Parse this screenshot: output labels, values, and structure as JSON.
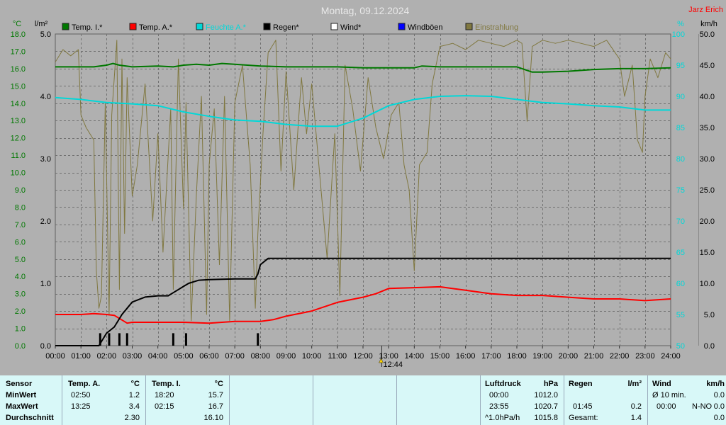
{
  "title": "Montag, 09.12.2024",
  "author": "Jarz Erich",
  "colors": {
    "background": "#b0b0b0",
    "grid": "#707070",
    "temp_inside": "#007800",
    "temp_outside": "#ff0000",
    "humidity": "#00d8d8",
    "rain": "#000000",
    "wind": "#ffffff",
    "gusts": "#0000ff",
    "lux": "#807840",
    "axis_left": "#007800",
    "axis_right": "#00d8d8"
  },
  "axes": {
    "temp_unit": "°C",
    "rain_unit": "l/m²",
    "humidity_unit": "%",
    "wind_unit": "km/h",
    "temp_ticks": [
      "0.0",
      "1.0",
      "2.0",
      "3.0",
      "4.0",
      "5.0",
      "6.0",
      "7.0",
      "8.0",
      "9.0",
      "10.0",
      "11.0",
      "12.0",
      "13.0",
      "14.0",
      "15.0",
      "16.0",
      "17.0",
      "18.0"
    ],
    "rain_ticks": [
      "0.0",
      "1.0",
      "2.0",
      "3.0",
      "4.0",
      "5.0"
    ],
    "humidity_ticks": [
      "50",
      "55",
      "60",
      "65",
      "70",
      "75",
      "80",
      "85",
      "90",
      "95",
      "100"
    ],
    "wind_ticks": [
      "0.0",
      "5.0",
      "10.0",
      "15.0",
      "20.0",
      "25.0",
      "30.0",
      "35.0",
      "40.0",
      "45.0",
      "50.0"
    ],
    "x_ticks": [
      "00:00",
      "01:00",
      "02:00",
      "03:00",
      "04:00",
      "05:00",
      "06:00",
      "07:00",
      "08:00",
      "09:00",
      "10:00",
      "11:00",
      "12:00",
      "13:00",
      "14:00",
      "15:00",
      "16:00",
      "17:00",
      "18:00",
      "19:00",
      "20:00",
      "21:00",
      "22:00",
      "23:00",
      "24:00"
    ],
    "cursor_label": "12:44"
  },
  "legend": [
    {
      "label": "Temp. I.*",
      "color": "#007800"
    },
    {
      "label": "Temp. A.*",
      "color": "#ff0000"
    },
    {
      "label": "Feuchte A.*",
      "color": "#00d8d8"
    },
    {
      "label": "Regen*",
      "color": "#000000"
    },
    {
      "label": "Wind*",
      "color": "#ffffff"
    },
    {
      "label": "Windböen",
      "color": "#0000ff"
    },
    {
      "label": "Einstrahlung",
      "color": "#807840"
    }
  ],
  "chart_data": {
    "type": "line",
    "title": "Montag, 09.12.2024",
    "x_unit": "hours",
    "xlim": [
      0,
      24
    ],
    "series": [
      {
        "name": "Temp. I.*",
        "axis": "temp",
        "color": "#007800",
        "x": [
          0,
          1,
          1.5,
          2,
          2.25,
          2.5,
          3,
          4,
          4.6,
          5,
          5.5,
          6,
          6.5,
          7,
          7.5,
          8,
          9,
          10,
          11,
          12,
          13,
          14,
          14.3,
          15,
          16,
          17,
          18,
          18.6,
          19,
          20,
          21,
          22,
          23,
          24
        ],
        "y": [
          16.1,
          16.1,
          16.1,
          16.2,
          16.3,
          16.2,
          16.1,
          16.15,
          16.1,
          16.2,
          16.25,
          16.2,
          16.3,
          16.25,
          16.2,
          16.15,
          16.1,
          16.1,
          16.1,
          16.05,
          16.05,
          16.05,
          16.15,
          16.1,
          16.1,
          16.1,
          16.1,
          15.8,
          15.8,
          15.85,
          15.95,
          16.0,
          16.0,
          16.05
        ]
      },
      {
        "name": "Temp. A.*",
        "axis": "temp",
        "color": "#ff0000",
        "x": [
          0,
          1,
          1.5,
          2,
          2.3,
          2.8,
          3,
          4,
          5,
          6,
          7,
          8,
          8.5,
          9,
          10,
          11,
          12,
          12.5,
          13,
          14,
          15,
          16,
          17,
          18,
          19,
          20,
          21,
          22,
          23,
          24
        ],
        "y": [
          1.8,
          1.8,
          1.85,
          1.8,
          1.75,
          1.3,
          1.35,
          1.35,
          1.35,
          1.3,
          1.4,
          1.4,
          1.5,
          1.7,
          2.0,
          2.5,
          2.8,
          3.0,
          3.3,
          3.35,
          3.4,
          3.2,
          3.0,
          2.9,
          2.9,
          2.8,
          2.7,
          2.7,
          2.6,
          2.7
        ]
      },
      {
        "name": "Feuchte A.*",
        "axis": "humidity",
        "color": "#00d8d8",
        "x": [
          0,
          1,
          2,
          3,
          4,
          5,
          6,
          7,
          8,
          9,
          10,
          11,
          12,
          13,
          14,
          15,
          16,
          17,
          18,
          19,
          20,
          21,
          22,
          23,
          24
        ],
        "y": [
          89.8,
          89.5,
          89,
          88.8,
          88.5,
          87.5,
          86.8,
          86.2,
          86,
          85.5,
          85.2,
          85.2,
          86.5,
          88.5,
          89.5,
          90,
          90.1,
          90,
          89.5,
          89,
          88.8,
          88.5,
          88.3,
          87.8,
          87.8
        ]
      },
      {
        "name": "Regen*",
        "axis": "rain",
        "color": "#000000",
        "x": [
          0,
          1.7,
          2,
          2.3,
          2.6,
          2.8,
          3,
          3.5,
          4,
          4.4,
          4.6,
          4.8,
          5,
          5.2,
          5.6,
          6,
          7,
          7.8,
          7.9,
          8,
          8.3,
          9,
          10,
          12,
          14,
          16,
          18,
          20,
          22,
          24
        ],
        "y": [
          0,
          0,
          0.2,
          0.3,
          0.5,
          0.6,
          0.7,
          0.78,
          0.8,
          0.8,
          0.85,
          0.9,
          0.95,
          1.0,
          1.05,
          1.06,
          1.07,
          1.07,
          1.15,
          1.3,
          1.4,
          1.4,
          1.4,
          1.4,
          1.4,
          1.4,
          1.4,
          1.4,
          1.4,
          1.4
        ]
      },
      {
        "name": "Einstrahlung",
        "axis": "wind",
        "color": "#807840",
        "x": [
          0,
          0.3,
          0.6,
          0.9,
          1.0,
          1.2,
          1.5,
          1.6,
          1.7,
          1.8,
          1.95,
          2.1,
          2.2,
          2.4,
          2.5,
          2.6,
          2.7,
          2.8,
          3.0,
          3.2,
          3.5,
          3.8,
          4.0,
          4.2,
          4.5,
          4.6,
          4.8,
          5.0,
          5.1,
          5.3,
          5.5,
          5.7,
          5.9,
          6.0,
          6.2,
          6.4,
          6.6,
          6.8,
          7.0,
          7.3,
          7.6,
          7.8,
          7.9,
          8.1,
          8.3,
          8.6,
          8.8,
          9.0,
          9.3,
          9.6,
          9.8,
          10.0,
          10.3,
          10.6,
          10.9,
          11.1,
          11.3,
          11.6,
          11.9,
          12.2,
          12.5,
          12.8,
          13.1,
          13.4,
          13.6,
          13.8,
          14.0,
          14.2,
          14.5,
          14.7,
          15.0,
          15.5,
          16.0,
          16.5,
          17.0,
          17.5,
          18.0,
          18.2,
          18.4,
          18.6,
          19.0,
          19.5,
          20.0,
          20.5,
          21.0,
          21.5,
          22.0,
          22.2,
          22.5,
          22.7,
          22.9,
          23.0,
          23.2,
          23.5,
          23.8,
          24.0
        ],
        "y": [
          45.5,
          47.5,
          46.5,
          47.5,
          37,
          35,
          33,
          12,
          6,
          8,
          39,
          5,
          37,
          49,
          9,
          46,
          18,
          43,
          24,
          29,
          42,
          20,
          34,
          15,
          38,
          9,
          46,
          22,
          39,
          4,
          24,
          40,
          5,
          29,
          38,
          13,
          40,
          4,
          39,
          45,
          29,
          6,
          18,
          34,
          47,
          49,
          28,
          44,
          25,
          43,
          34,
          42,
          28,
          14,
          34,
          8,
          45,
          38,
          28,
          43,
          35,
          30,
          37,
          39,
          29,
          25,
          12,
          29,
          31,
          42,
          48,
          48.5,
          47.5,
          49,
          48.5,
          48,
          49,
          48.5,
          36,
          48,
          49,
          48.5,
          49,
          48.5,
          48,
          49,
          46,
          40,
          45,
          33,
          31,
          40,
          46,
          43,
          47,
          46
        ]
      }
    ],
    "rain_bars": [
      {
        "x": 1.75,
        "y": 0.2
      },
      {
        "x": 2.1,
        "y": 0.2
      },
      {
        "x": 2.5,
        "y": 0.2
      },
      {
        "x": 2.8,
        "y": 0.2
      },
      {
        "x": 4.6,
        "y": 0.2
      },
      {
        "x": 5.1,
        "y": 0.2
      },
      {
        "x": 7.9,
        "y": 0.2
      }
    ]
  },
  "stats": {
    "sensor": {
      "header": "Sensor",
      "rows": [
        "MinWert",
        "MaxWert",
        "Durchschnitt"
      ]
    },
    "temp_a": {
      "header": "Temp. A.",
      "unit": "°C",
      "times": [
        "02:50",
        "13:25",
        ""
      ],
      "values": [
        "1.2",
        "3.4",
        "2.30"
      ]
    },
    "temp_i": {
      "header": "Temp. I.",
      "unit": "°C",
      "times": [
        "18:20",
        "02:15",
        ""
      ],
      "values": [
        "15.7",
        "16.7",
        "16.10"
      ]
    },
    "pressure": {
      "header": "Luftdruck",
      "unit": "hPa",
      "times": [
        "00:00",
        "23:55",
        "^1.0hPa/h"
      ],
      "values": [
        "1012.0",
        "1020.7",
        "1015.8"
      ]
    },
    "rain": {
      "header": "Regen",
      "unit": "l/m²",
      "times": [
        "",
        "01:45",
        "Gesamt:"
      ],
      "values": [
        "",
        "0.2",
        "1.4"
      ]
    },
    "wind": {
      "header": "Wind",
      "unit": "km/h",
      "labels": [
        "Ø 10 min.",
        "00:00",
        ""
      ],
      "mids": [
        "",
        "N-NO",
        ""
      ],
      "values": [
        "0.0",
        "0.0",
        "0.0"
      ]
    }
  }
}
